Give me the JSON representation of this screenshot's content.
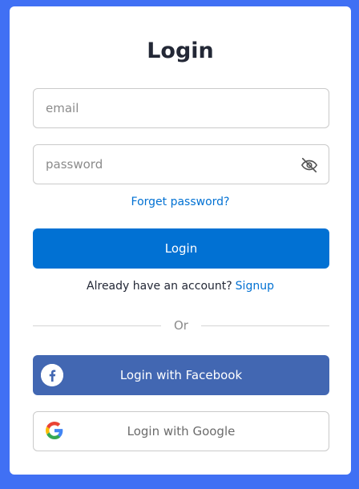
{
  "title": "Login",
  "email": {
    "placeholder": "email",
    "value": ""
  },
  "password": {
    "placeholder": "password",
    "value": "",
    "toggle_icon": "eye-off-icon"
  },
  "forgot_link": "Forget password?",
  "login_button": "Login",
  "signup": {
    "prompt": "Already have an account?",
    "link": "Signup"
  },
  "divider_text": "Or",
  "facebook_button": {
    "label": "Login with Facebook",
    "icon": "facebook-icon"
  },
  "google_button": {
    "label": "Login with Google",
    "icon": "google-icon"
  },
  "colors": {
    "background": "#4070f4",
    "primary": "#0171d3",
    "facebook": "#4267b2",
    "text": "#232836"
  }
}
